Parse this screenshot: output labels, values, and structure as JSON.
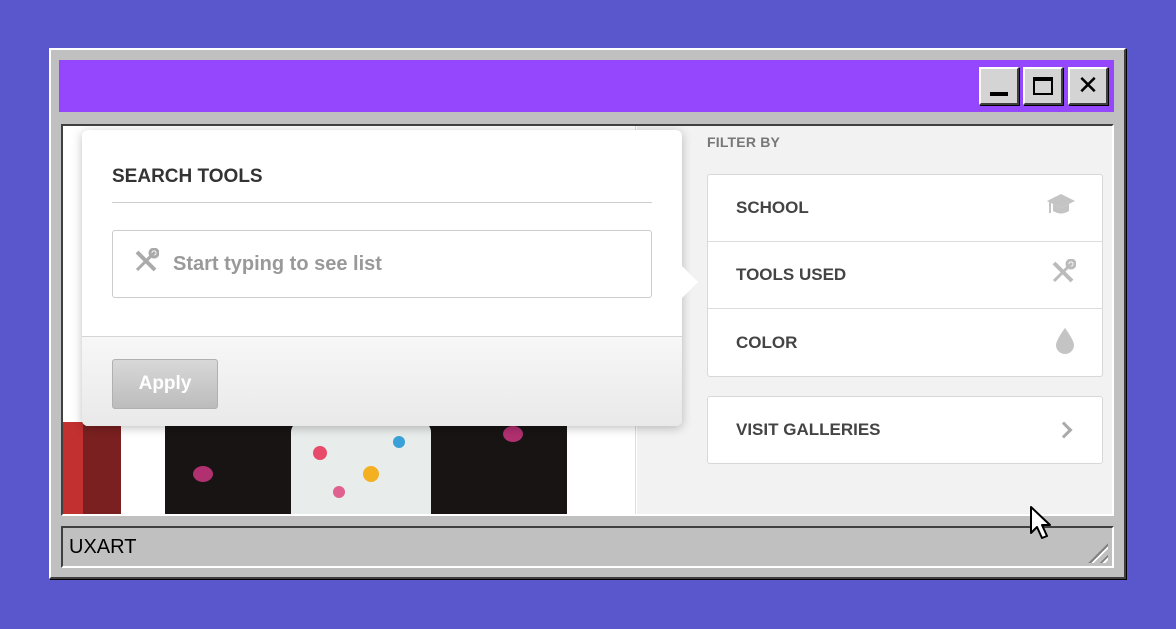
{
  "window": {
    "buttons": {
      "minimize": "minimize",
      "maximize": "maximize",
      "close": "✕"
    }
  },
  "popover": {
    "title": "SEARCH TOOLS",
    "search_placeholder": "Start typing to see list",
    "search_value": "",
    "search_icon": "tools-icon",
    "apply_label": "Apply"
  },
  "filter": {
    "title": "FILTER BY",
    "items": [
      {
        "label": "SCHOOL",
        "icon": "graduation-cap-icon"
      },
      {
        "label": "TOOLS USED",
        "icon": "tools-icon"
      },
      {
        "label": "COLOR",
        "icon": "droplet-icon"
      }
    ],
    "galleries_label": "VISIT GALLERIES"
  },
  "statusbar": {
    "text": "UXART"
  },
  "colors": {
    "desktop": "#5a57cc",
    "titlebar": "#9447fc",
    "window_chrome": "#c0c0c0"
  }
}
